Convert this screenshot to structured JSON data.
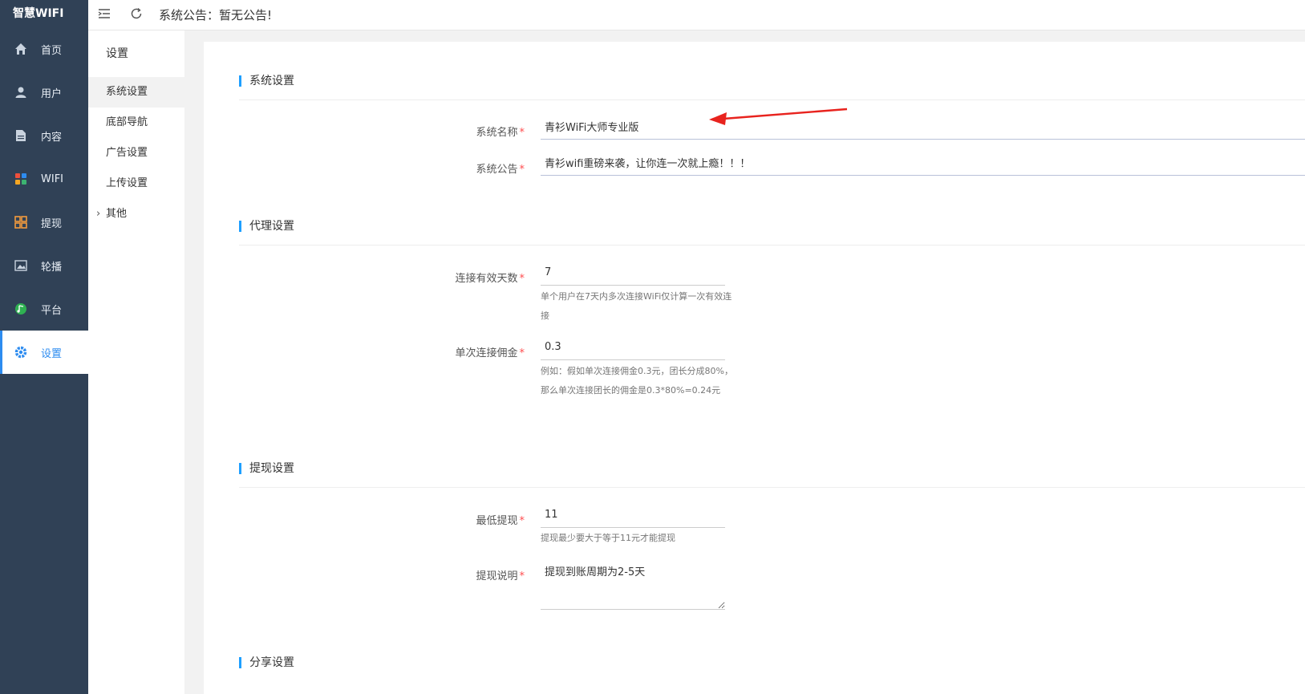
{
  "brand": "智慧WIFI",
  "topbar": {
    "notice": "系统公告：暂无公告!"
  },
  "nav": [
    {
      "label": "首页",
      "icon": "home-icon"
    },
    {
      "label": "用户",
      "icon": "user-icon"
    },
    {
      "label": "内容",
      "icon": "document-icon"
    },
    {
      "label": "WIFI",
      "icon": "apps-icon"
    },
    {
      "label": "提现",
      "icon": "grid-icon"
    },
    {
      "label": "轮播",
      "icon": "image-icon"
    },
    {
      "label": "平台",
      "icon": "platform-icon"
    },
    {
      "label": "设置",
      "icon": "gear-icon"
    }
  ],
  "submenu": {
    "title": "设置",
    "items": [
      "系统设置",
      "底部导航",
      "广告设置",
      "上传设置",
      "其他"
    ]
  },
  "sections": {
    "system": {
      "heading": "系统设置",
      "name_label": "系统名称",
      "name_value": "青衫WiFi大师专业版",
      "notice_label": "系统公告",
      "notice_value": "青衫wifi重磅来袭，让你连一次就上瘾！！！"
    },
    "agent": {
      "heading": "代理设置",
      "days_label": "连接有效天数",
      "days_value": "7",
      "days_hint": "单个用户在7天内多次连接WiFi仅计算一次有效连接",
      "commission_label": "单次连接佣金",
      "commission_value": "0.3",
      "commission_hint": "例如：假如单次连接佣金0.3元，团长分成80%，那么单次连接团长的佣金是0.3*80%=0.24元"
    },
    "withdraw": {
      "heading": "提现设置",
      "min_label": "最低提现",
      "min_value": "11",
      "min_hint": "提现最少要大于等于11元才能提现",
      "desc_label": "提现说明",
      "desc_value": "提现到账周期为2-5天"
    },
    "share": {
      "heading": "分享设置"
    }
  },
  "colors": {
    "sidebar": "#304156",
    "accent": "#2d8cf0",
    "required": "#ff4d4f",
    "arrow": "#e8231e"
  }
}
